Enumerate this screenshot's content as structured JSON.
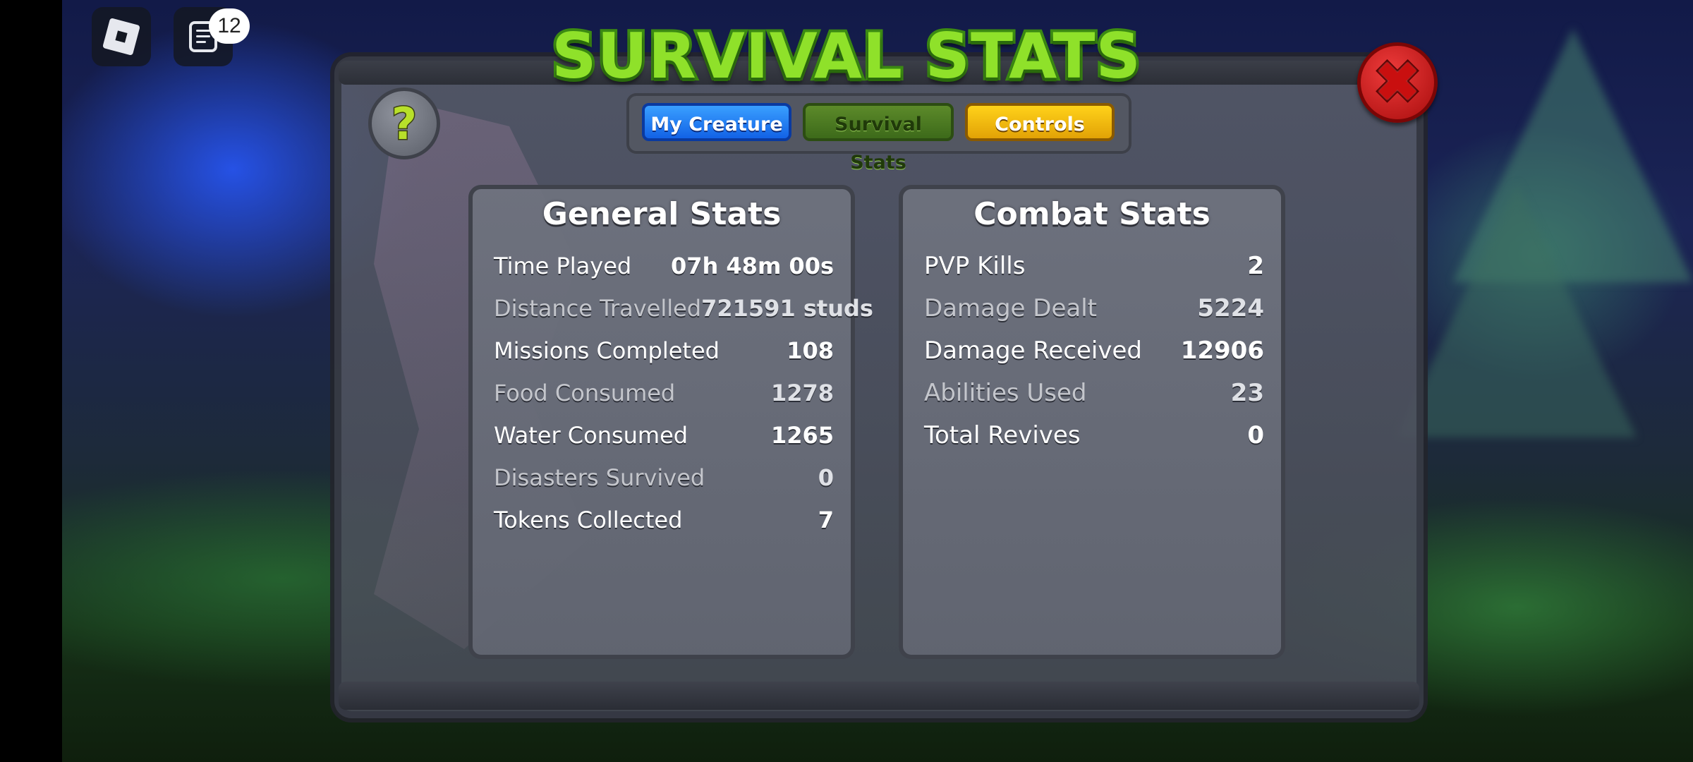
{
  "title": "SURVIVAL STATS",
  "topbar": {
    "chat_badge_count": "12"
  },
  "help_button": {
    "glyph": "?"
  },
  "close_button": {
    "glyph": "✖"
  },
  "tabs": [
    {
      "label": "My Creature",
      "color": "#1f7bf2"
    },
    {
      "label": "Survival Stats",
      "color": "#4c7a22"
    },
    {
      "label": "Controls",
      "color": "#f2b80c"
    }
  ],
  "general_stats": {
    "title": "General Stats",
    "rows": [
      {
        "label": "Time Played",
        "value": "07h 48m 00s"
      },
      {
        "label": "Distance Travelled",
        "value": "721591 studs"
      },
      {
        "label": "Missions Completed",
        "value": "108"
      },
      {
        "label": "Food Consumed",
        "value": "1278"
      },
      {
        "label": "Water Consumed",
        "value": "1265"
      },
      {
        "label": "Disasters Survived",
        "value": "0"
      },
      {
        "label": "Tokens Collected",
        "value": "7"
      }
    ]
  },
  "combat_stats": {
    "title": "Combat Stats",
    "rows": [
      {
        "label": "PVP Kills",
        "value": "2"
      },
      {
        "label": "Damage Dealt",
        "value": "5224"
      },
      {
        "label": "Damage Received",
        "value": "12906"
      },
      {
        "label": "Abilities Used",
        "value": "23"
      },
      {
        "label": "Total Revives",
        "value": "0"
      }
    ]
  },
  "icons": {
    "roblox_menu": "roblox-logo-icon",
    "chat": "chat-icon",
    "help": "question-icon",
    "close": "close-icon"
  },
  "colors": {
    "title_green": "#8fe12a",
    "close_red": "#c90f0f",
    "panel_gray": "#585c68"
  }
}
